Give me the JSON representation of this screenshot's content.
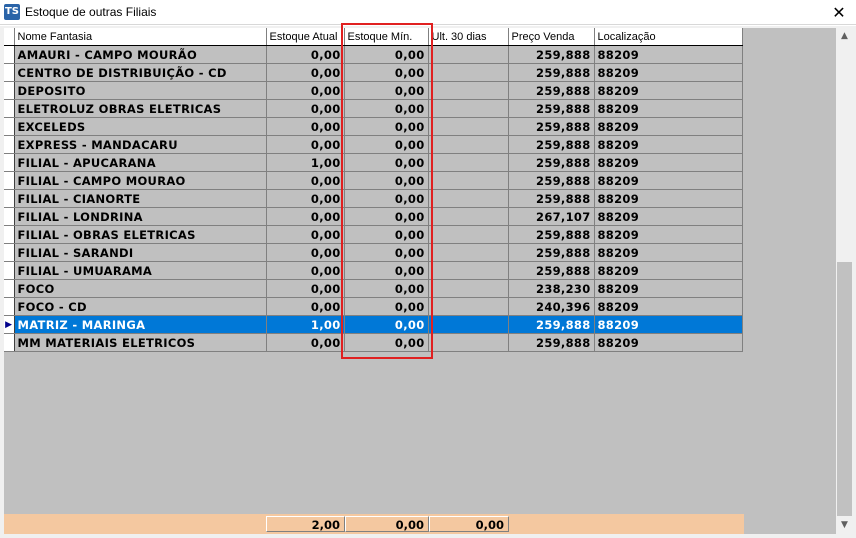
{
  "window": {
    "title": "Estoque de outras Filiais",
    "icon_text": "TS",
    "close_symbol": "✕"
  },
  "columns": [
    "Nome Fantasia",
    "Estoque Atual",
    "Estoque Mín.",
    "Ult. 30 dias",
    "Preço Venda",
    "Localização"
  ],
  "rows": [
    {
      "nome": "AMAURI - CAMPO MOURÃO",
      "estoque_atual": "0,00",
      "estoque_min": "0,00",
      "ult30": "",
      "preco": "259,888",
      "local": "88209"
    },
    {
      "nome": "CENTRO DE DISTRIBUIÇÃO - CD",
      "estoque_atual": "0,00",
      "estoque_min": "0,00",
      "ult30": "",
      "preco": "259,888",
      "local": "88209"
    },
    {
      "nome": "DEPOSITO",
      "estoque_atual": "0,00",
      "estoque_min": "0,00",
      "ult30": "",
      "preco": "259,888",
      "local": "88209"
    },
    {
      "nome": "ELETROLUZ OBRAS ELETRICAS",
      "estoque_atual": "0,00",
      "estoque_min": "0,00",
      "ult30": "",
      "preco": "259,888",
      "local": "88209"
    },
    {
      "nome": "EXCELEDS",
      "estoque_atual": "0,00",
      "estoque_min": "0,00",
      "ult30": "",
      "preco": "259,888",
      "local": "88209"
    },
    {
      "nome": "EXPRESS - MANDACARU",
      "estoque_atual": "0,00",
      "estoque_min": "0,00",
      "ult30": "",
      "preco": "259,888",
      "local": "88209"
    },
    {
      "nome": "FILIAL - APUCARANA",
      "estoque_atual": "1,00",
      "estoque_min": "0,00",
      "ult30": "",
      "preco": "259,888",
      "local": "88209"
    },
    {
      "nome": "FILIAL - CAMPO MOURAO",
      "estoque_atual": "0,00",
      "estoque_min": "0,00",
      "ult30": "",
      "preco": "259,888",
      "local": "88209"
    },
    {
      "nome": "FILIAL - CIANORTE",
      "estoque_atual": "0,00",
      "estoque_min": "0,00",
      "ult30": "",
      "preco": "259,888",
      "local": "88209"
    },
    {
      "nome": "FILIAL - LONDRINA",
      "estoque_atual": "0,00",
      "estoque_min": "0,00",
      "ult30": "",
      "preco": "267,107",
      "local": "88209"
    },
    {
      "nome": "FILIAL - OBRAS ELETRICAS",
      "estoque_atual": "0,00",
      "estoque_min": "0,00",
      "ult30": "",
      "preco": "259,888",
      "local": "88209"
    },
    {
      "nome": "FILIAL - SARANDI",
      "estoque_atual": "0,00",
      "estoque_min": "0,00",
      "ult30": "",
      "preco": "259,888",
      "local": "88209"
    },
    {
      "nome": "FILIAL - UMUARAMA",
      "estoque_atual": "0,00",
      "estoque_min": "0,00",
      "ult30": "",
      "preco": "259,888",
      "local": "88209"
    },
    {
      "nome": "FOCO",
      "estoque_atual": "0,00",
      "estoque_min": "0,00",
      "ult30": "",
      "preco": "238,230",
      "local": "88209"
    },
    {
      "nome": "FOCO - CD",
      "estoque_atual": "0,00",
      "estoque_min": "0,00",
      "ult30": "",
      "preco": "240,396",
      "local": "88209"
    },
    {
      "nome": "MATRIZ - MARINGA",
      "estoque_atual": "1,00",
      "estoque_min": "0,00",
      "ult30": "",
      "preco": "259,888",
      "local": "88209",
      "selected": true
    },
    {
      "nome": "MM MATERIAIS ELETRICOS",
      "estoque_atual": "0,00",
      "estoque_min": "0,00",
      "ult30": "",
      "preco": "259,888",
      "local": "88209"
    }
  ],
  "totals": {
    "estoque_atual": "2,00",
    "estoque_min": "0,00",
    "ult30": "0,00"
  },
  "colors": {
    "selection": "#0078d7",
    "footer": "#f4c8a0",
    "highlight_box": "#e02020",
    "grid_bg": "#c0c0c0"
  },
  "icons": {
    "row_indicator": "triangle-right",
    "scroll_up": "arrow-up",
    "scroll_down": "arrow-down"
  }
}
